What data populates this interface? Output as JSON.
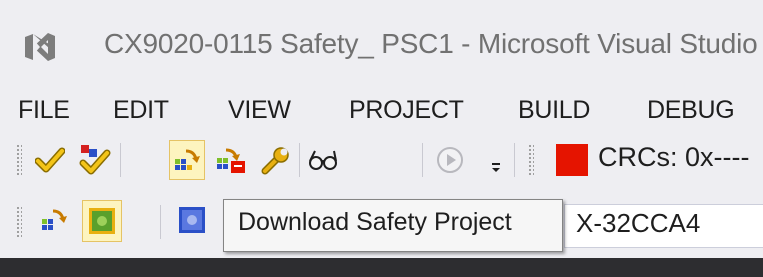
{
  "window": {
    "title": "CX9020-0115 Safety_ PSC1 - Microsoft Visual Studio",
    "logo_icon": "visual-studio-logo"
  },
  "menu": {
    "items": [
      "FILE",
      "EDIT",
      "VIEW",
      "PROJECT",
      "BUILD",
      "DEBUG"
    ]
  },
  "toolbar1": {
    "buttons": [
      "check-icon",
      "verify-all-icon",
      "download-icon",
      "delete-download-icon",
      "wrench-icon",
      "glasses-icon",
      "play-icon",
      "overflow-icon"
    ],
    "crc_label": "CRCs: 0x----"
  },
  "toolbar2": {
    "buttons": [
      "download-safety-icon",
      "safety-project-icon",
      "target-system-icon"
    ],
    "target_value": "X-32CCA4"
  },
  "tooltip": {
    "text": "Download Safety Project"
  },
  "colors": {
    "background": "#eeeef2",
    "active_button_bg": "#fdf4bf",
    "active_button_border": "#e5c365",
    "crc_status": "#e51400",
    "dark_strip": "#2d2d30"
  }
}
